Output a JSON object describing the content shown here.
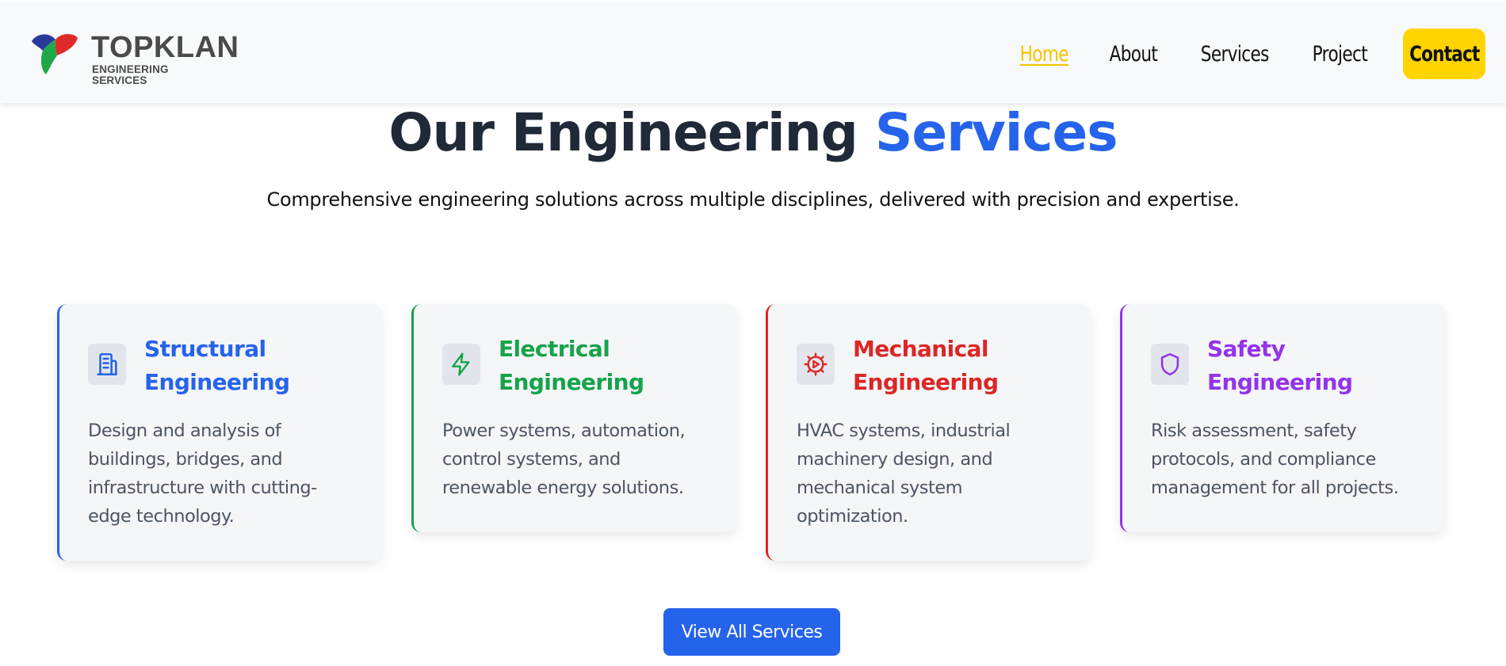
{
  "header": {
    "logo": {
      "title": "TOPKLAN",
      "subtitle": "ENGINEERING SERVICES"
    },
    "nav": [
      {
        "label": "Home",
        "active": true
      },
      {
        "label": "About",
        "active": false
      },
      {
        "label": "Services",
        "active": false
      },
      {
        "label": "Project",
        "active": false
      }
    ],
    "contact_label": "Contact"
  },
  "hero": {
    "title_main": "Our Engineering",
    "title_accent": "Services",
    "subtitle": "Comprehensive engineering solutions across multiple disciplines, delivered with precision and expertise."
  },
  "services": [
    {
      "title_line1": "Structural",
      "title_line2": "Engineering",
      "description": "Design and analysis of buildings, bridges, and infrastructure with cutting-edge technology.",
      "icon": "building-icon",
      "color": "#2563eb"
    },
    {
      "title_line1": "Electrical",
      "title_line2": "Engineering",
      "description": "Power systems, automation, control systems, and renewable energy solutions.",
      "icon": "lightning-bolt-icon",
      "color": "#16a34a"
    },
    {
      "title_line1": "Mechanical",
      "title_line2": "Engineering",
      "description": "HVAC systems, industrial machinery design, and mechanical system optimization.",
      "icon": "cog-icon",
      "color": "#dc2626"
    },
    {
      "title_line1": "Safety",
      "title_line2": "Engineering",
      "description": "Risk assessment, safety protocols, and compliance management for all projects.",
      "icon": "shield-icon",
      "color": "#9333ea"
    }
  ],
  "view_all_label": "View All Services",
  "colors": {
    "primary": "#2563eb",
    "nav_active": "#f5c400",
    "contact_bg": "#ffd400",
    "heading": "#1f2937"
  }
}
